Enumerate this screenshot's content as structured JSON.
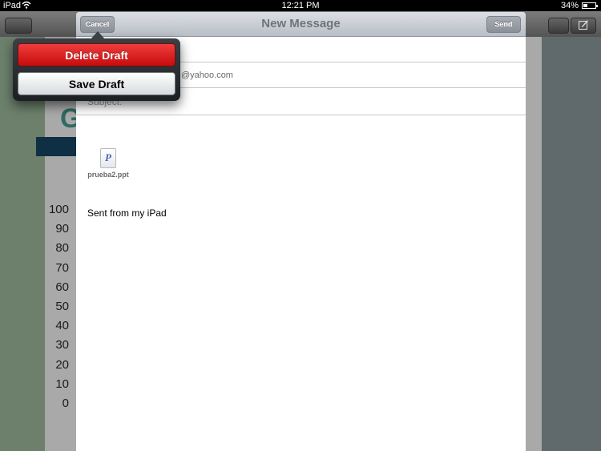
{
  "status_bar": {
    "device": "iPad",
    "time": "12:21 PM",
    "battery": "34%",
    "battery_level": 0.34
  },
  "background_app": {
    "heading_letter": "G",
    "chart_axis_ticks": [
      "100",
      "90",
      "80",
      "70",
      "60",
      "50",
      "40",
      "30",
      "20",
      "10",
      "0"
    ]
  },
  "compose": {
    "title": "New Message",
    "cancel_label": "Cancel",
    "send_label": "Send",
    "to_value_visible": "@yahoo.com",
    "subject_label": "Subject:",
    "attachment": {
      "icon_letter": "P",
      "name": "prueba2.ppt"
    },
    "body": "Sent from my iPad"
  },
  "popover": {
    "delete_label": "Delete Draft",
    "save_label": "Save Draft"
  },
  "colors": {
    "delete_red": "#d81e1e",
    "popover_dark": "#2a2e32",
    "background_green": "#6c806c"
  }
}
